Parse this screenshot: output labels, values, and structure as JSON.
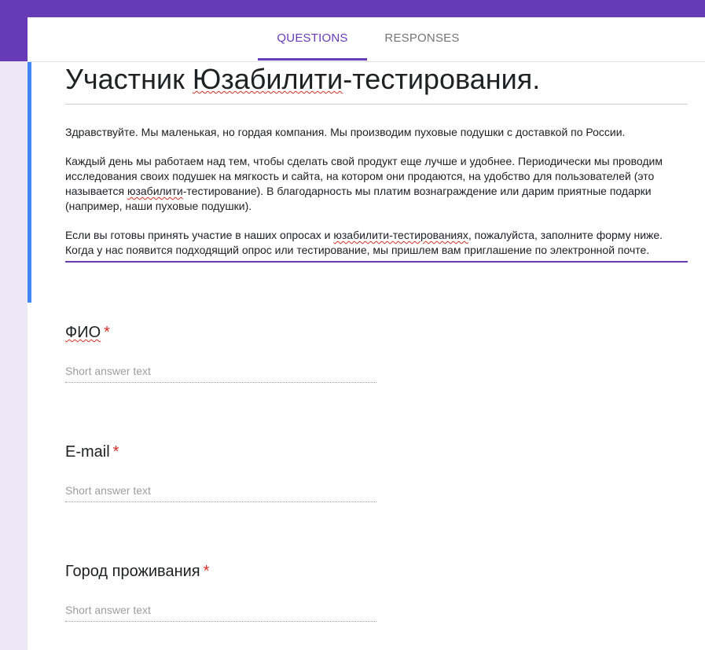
{
  "tabs": {
    "questions": "QUESTIONS",
    "responses": "RESPONSES"
  },
  "form": {
    "title_part1": "Участник ",
    "title_part2": "Юзабилити",
    "title_part3": "-тестирования.",
    "description": {
      "p1": "Здравствуйте. Мы маленькая, но гордая компания. Мы производим пуховые подушки с доставкой по России.",
      "p2_a": "Каждый день мы работаем над тем, чтобы сделать свой продукт еще лучше и удобнее.  Периодически мы проводим исследования своих подушек на мягкость и сайта, на котором они продаются, на удобство для пользователей (это называется ",
      "p2_b": "юзабилити",
      "p2_c": "-тестирование). В благодарность мы платим вознаграждение или дарим приятные подарки (например, наши пуховые подушки).",
      "p3_a": " Если вы готовы принять участие в наших опросах и ",
      "p3_b": "юзабилити-тестированиях",
      "p3_c": ", пожалуйста, заполните форму ниже. Когда у нас появится подходящий опрос или тестирование, мы пришлем вам приглашение по электронной почте."
    }
  },
  "questions": [
    {
      "label": "ФИО",
      "required_mark": "*",
      "placeholder": "Short answer text"
    },
    {
      "label": "E-mail",
      "required_mark": "*",
      "placeholder": "Short answer text"
    },
    {
      "label": "Город проживания",
      "required_mark": "*",
      "placeholder": "Short answer text"
    }
  ],
  "colors": {
    "brand": "#673ab7",
    "accent": "#4285f4",
    "required": "#d93025",
    "background": "#ede7f6"
  }
}
